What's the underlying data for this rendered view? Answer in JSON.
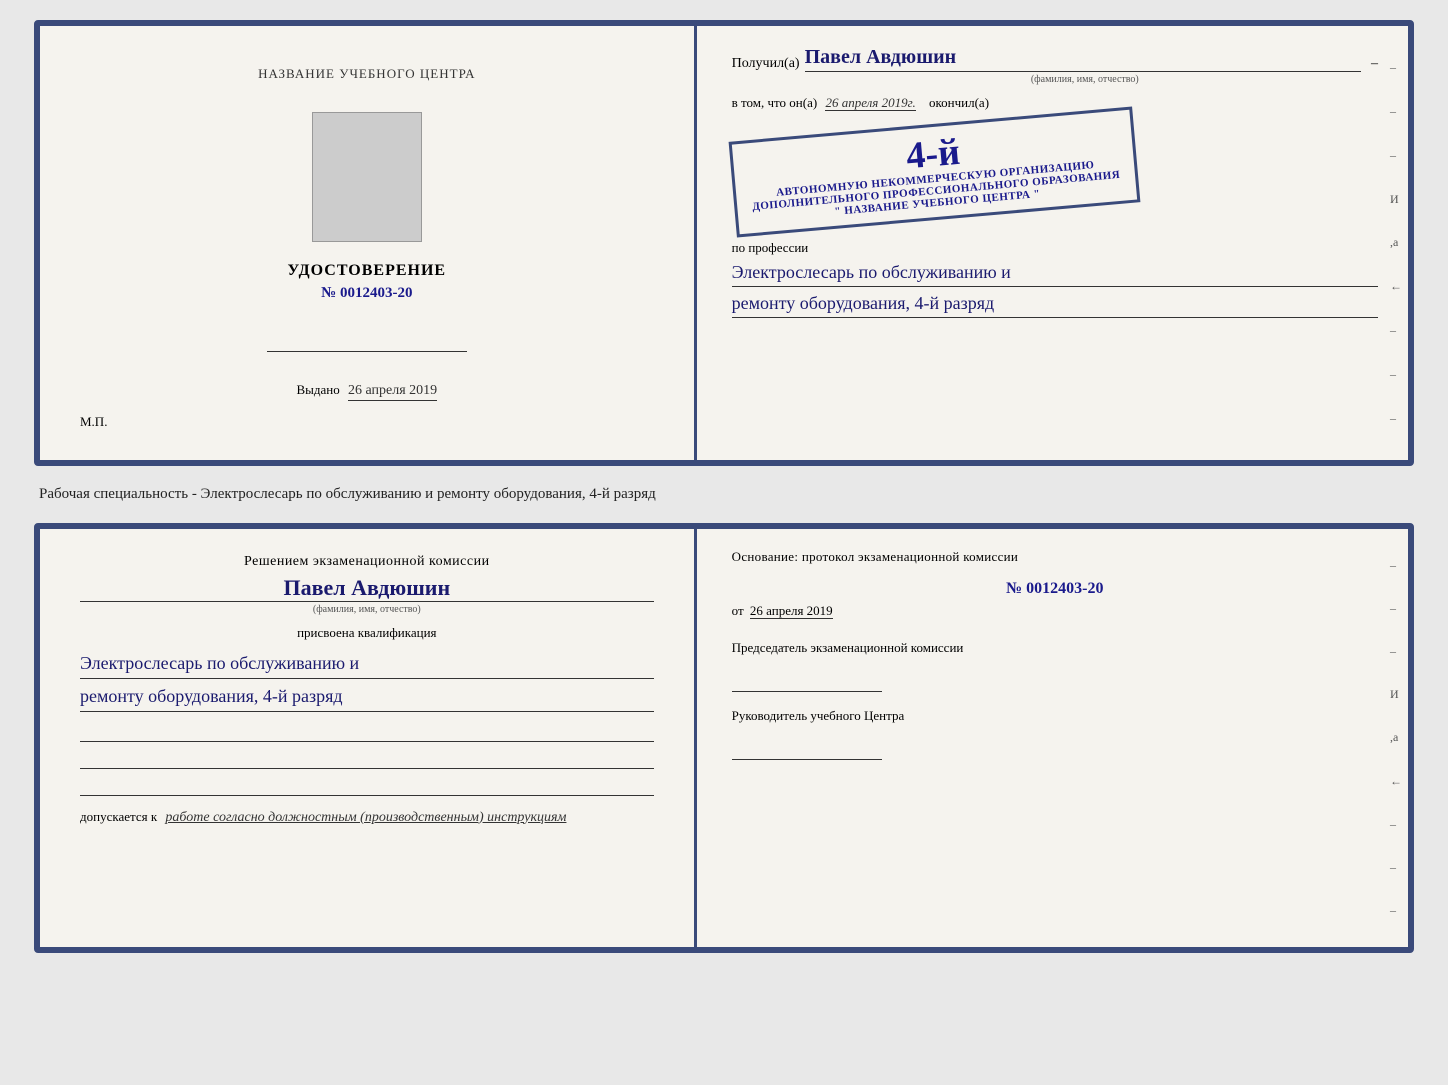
{
  "top_document": {
    "left": {
      "title": "НАЗВАНИЕ УЧЕБНОГО ЦЕНТРА",
      "certificate_label": "УДОСТОВЕРЕНИЕ",
      "certificate_number": "№ 0012403-20",
      "vydano_label": "Выдано",
      "vydano_date": "26 апреля 2019",
      "mp_label": "М.П."
    },
    "right": {
      "poluchil_label": "Получил(a)",
      "person_name": "Павел Авдюшин",
      "fio_caption": "(фамилия, имя, отчество)",
      "vtom_label": "в том, что он(a)",
      "date_value": "26 апреля 2019г.",
      "okonchil_label": "окончил(a)",
      "stamp_line1": "АВТОНОМНУЮ НЕКОММЕРЧЕСКУЮ ОРГАНИЗАЦИЮ",
      "stamp_line2": "ДОПОЛНИТЕЛЬНОГО ПРОФЕССИОНАЛЬНОГО ОБРАЗОВАНИЯ",
      "stamp_center": "4-й",
      "stamp_line3": "\" НАЗВАНИЕ УЧЕБНОГО ЦЕНТРА \"",
      "po_professii": "по профессии",
      "profession_line1": "Электрослесарь по обслуживанию и",
      "profession_line2": "ремонту оборудования, 4-й разряд"
    },
    "dashes": [
      "-",
      "-",
      "-",
      "И",
      ",а",
      "←",
      "-",
      "-",
      "-"
    ]
  },
  "middle_label": {
    "text": "Рабочая специальность - Электрослесарь по обслуживанию и ремонту оборудования, 4-й разряд"
  },
  "bottom_document": {
    "left": {
      "resheniem_title": "Решением экзаменационной  комиссии",
      "person_name": "Павел Авдюшин",
      "fio_caption": "(фамилия, имя, отчество)",
      "prisvoena_label": "присвоена квалификация",
      "qualification_line1": "Электрослесарь по обслуживанию и",
      "qualification_line2": "ремонту оборудования, 4-й разряд",
      "dopuskaetsya_label": "допускается к",
      "dopuskaetsya_value": "работе согласно должностным (производственным) инструкциям"
    },
    "right": {
      "osnovanie_label": "Основание: протокол экзаменационной  комиссии",
      "protocol_number": "№  0012403-20",
      "ot_label": "от",
      "ot_date": "26 апреля 2019",
      "predsedatel_label": "Председатель экзаменационной комиссии",
      "rukovoditel_label": "Руководитель учебного Центра"
    },
    "dashes": [
      "-",
      "-",
      "-",
      "И",
      ",а",
      "←",
      "-",
      "-",
      "-"
    ]
  }
}
